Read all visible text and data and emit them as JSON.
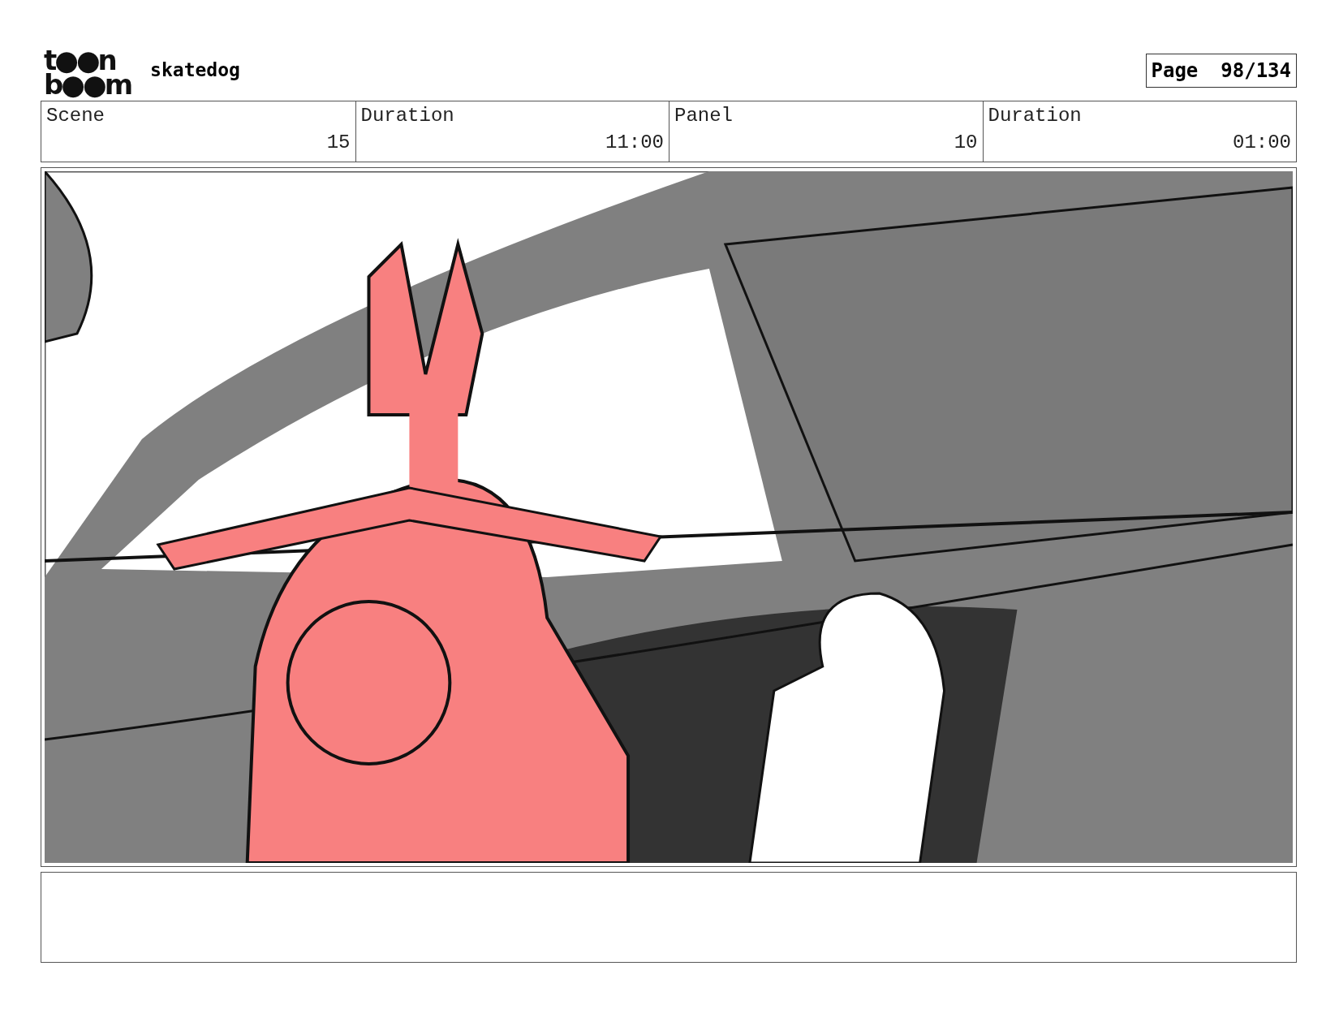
{
  "header": {
    "logo": [
      "t●●n",
      "b●●m"
    ],
    "project": "skatedog",
    "page_label": "Page",
    "page_number": "98/134"
  },
  "info": {
    "columns": [
      "Scene",
      "Duration",
      "Panel",
      "Duration"
    ],
    "rows": [
      [
        "15",
        "11:00",
        "10",
        "01:00"
      ]
    ]
  }
}
